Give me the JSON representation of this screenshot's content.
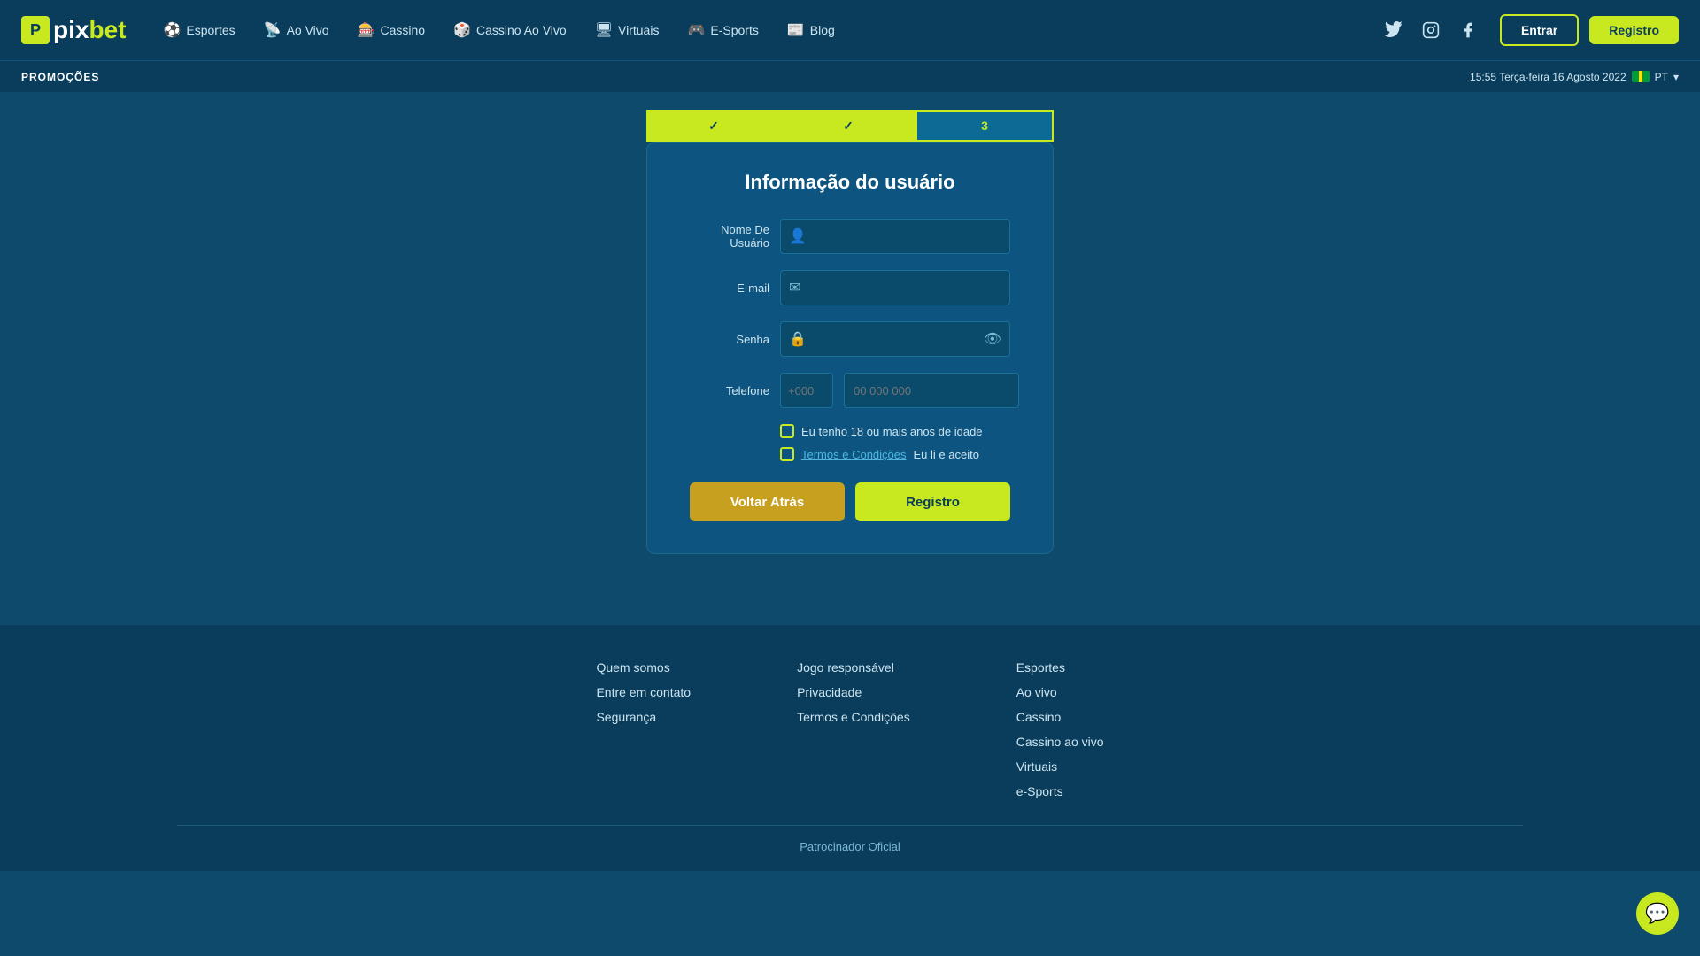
{
  "navbar": {
    "logo": "pixbet",
    "logo_pix": "pix",
    "logo_bet": "bet",
    "nav_items": [
      {
        "label": "Esportes",
        "icon": "⚽"
      },
      {
        "label": "Ao Vivo",
        "icon": "📡"
      },
      {
        "label": "Cassino",
        "icon": "🎰"
      },
      {
        "label": "Cassino Ao Vivo",
        "icon": "🎲"
      },
      {
        "label": "Virtuais",
        "icon": "🖥"
      },
      {
        "label": "E-Sports",
        "icon": "🎮"
      },
      {
        "label": "Blog",
        "icon": "📰"
      }
    ],
    "btn_entrar": "Entrar",
    "btn_registro": "Registro"
  },
  "promo_bar": {
    "label": "PROMOÇÕES",
    "datetime": "15:55 Terça-feira 16 Agosto 2022",
    "lang": "PT"
  },
  "steps": [
    {
      "label": "✓",
      "state": "done"
    },
    {
      "label": "✓",
      "state": "done"
    },
    {
      "label": "3",
      "state": "active"
    }
  ],
  "form": {
    "title": "Informação do usuário",
    "fields": {
      "username_label": "Nome De Usuário",
      "username_placeholder": "",
      "email_label": "E-mail",
      "email_placeholder": "",
      "password_label": "Senha",
      "password_placeholder": "",
      "phone_label": "Telefone",
      "phone_prefix_placeholder": "+000",
      "phone_number_placeholder": "00 000 000"
    },
    "checkboxes": {
      "age_label": "Eu tenho 18 ou mais anos de idade",
      "terms_link": "Termos e Condições",
      "terms_label": " Eu li e aceito"
    },
    "btn_back": "Voltar Atrás",
    "btn_register": "Registro"
  },
  "footer": {
    "col1": {
      "links": [
        "Quem somos",
        "Entre em contato",
        "Segurança"
      ]
    },
    "col2": {
      "links": [
        "Jogo responsável",
        "Privacidade",
        "Termos e Condições"
      ]
    },
    "col3": {
      "links": [
        "Esportes",
        "Ao vivo",
        "Cassino",
        "Cassino ao vivo",
        "Virtuais",
        "e-Sports"
      ]
    },
    "bottom": "Patrocinador Oficial"
  },
  "colors": {
    "accent": "#c8e820",
    "bg_dark": "#0a3d5c",
    "bg_medium": "#0d5580",
    "bg_light": "#0a4a6a"
  }
}
